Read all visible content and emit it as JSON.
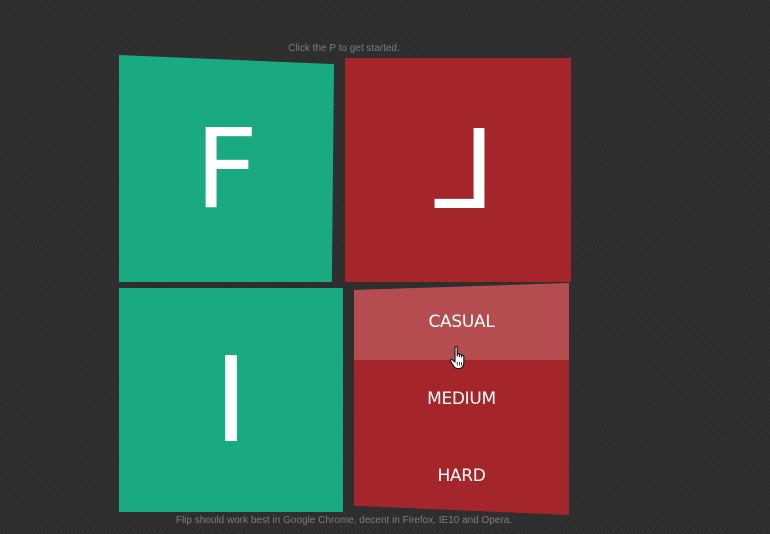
{
  "hint": "Click the P to get started.",
  "footer_note": "Flip should work best in Google Chrome, decent in Firefox, IE10 and Opera.",
  "tiles": {
    "f": "F",
    "l": "L",
    "i": "I"
  },
  "difficulty": {
    "options": [
      "CASUAL",
      "MEDIUM",
      "HARD"
    ],
    "hovered": "CASUAL"
  },
  "colors": {
    "green_tile": "#1aaa82",
    "red_tile": "#a5262a",
    "background": "#2e2e2e"
  },
  "cursor_icon": "hand-pointer-icon"
}
